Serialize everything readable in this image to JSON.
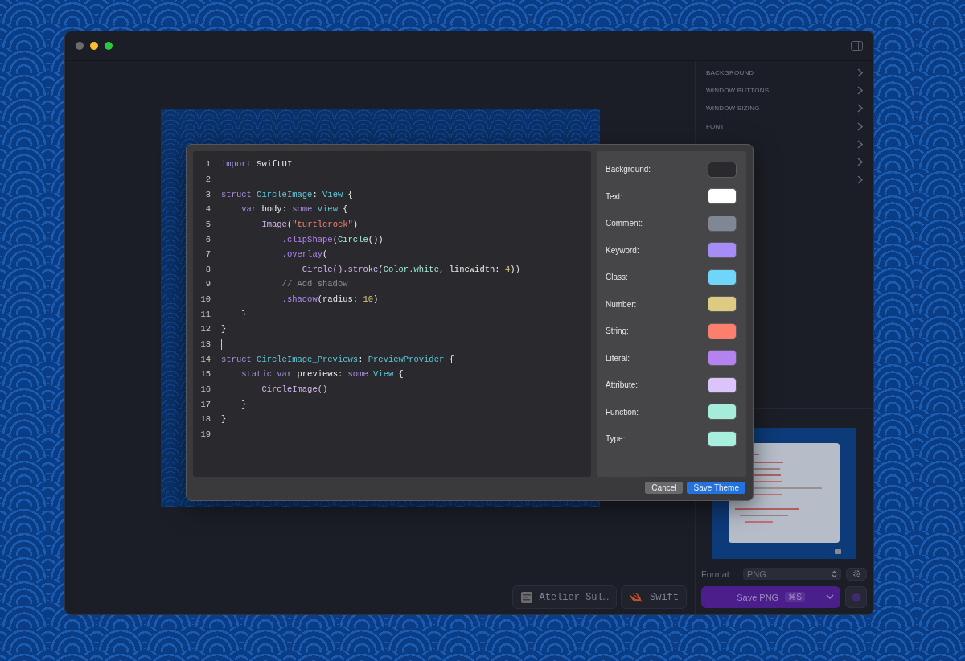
{
  "window": {
    "buttons": [
      {
        "color": "#6b6b70"
      },
      {
        "color": "#febc2e"
      },
      {
        "color": "#28c840"
      }
    ]
  },
  "sidebar": {
    "sections": [
      {
        "label": "BACKGROUND",
        "expandable": true
      },
      {
        "label": "WINDOW BUTTONS",
        "expandable": true
      },
      {
        "label": "WINDOW SIZING",
        "expandable": true
      },
      {
        "label": "FONT",
        "expandable": true
      },
      {
        "expandable": true
      },
      {
        "expandable": true
      },
      {
        "expandable": true
      }
    ],
    "format": {
      "label": "Format:",
      "value": "PNG"
    },
    "save": {
      "label": "Save PNG",
      "shortcut": "⌘S"
    }
  },
  "toolbar": {
    "theme_button": {
      "label": "Atelier Sul…"
    },
    "language_button": {
      "label": "Swift"
    }
  },
  "dialog": {
    "code": [
      {
        "n": "1",
        "tokens": [
          {
            "t": "import",
            "kind": "keyword"
          },
          {
            "t": " SwiftUI",
            "kind": "plain"
          }
        ]
      },
      {
        "n": "2"
      },
      {
        "n": "3",
        "tokens": [
          {
            "t": "struct ",
            "kind": "keyword"
          },
          {
            "t": "CircleImage",
            "kind": "class"
          },
          {
            "t": ": ",
            "kind": "plain"
          },
          {
            "t": "View",
            "kind": "class"
          },
          {
            "t": " {",
            "kind": "plain"
          }
        ]
      },
      {
        "n": "4",
        "tokens": [
          {
            "t": "    var",
            "kind": "keyword"
          },
          {
            "t": " body: ",
            "kind": "plain"
          },
          {
            "t": "some ",
            "kind": "keyword"
          },
          {
            "t": "View",
            "kind": "class"
          },
          {
            "t": " {",
            "kind": "plain"
          }
        ]
      },
      {
        "n": "5",
        "tokens": [
          {
            "t": "        Image",
            "kind": "attribute"
          },
          {
            "t": "(",
            "kind": "plain"
          },
          {
            "t": "\"turtlerock\"",
            "kind": "string"
          },
          {
            "t": ")",
            "kind": "plain"
          }
        ]
      },
      {
        "n": "6",
        "tokens": [
          {
            "t": "            .clipShape",
            "kind": "function"
          },
          {
            "t": "(",
            "kind": "plain"
          },
          {
            "t": "Circle",
            "kind": "type"
          },
          {
            "t": "())",
            "kind": "plain"
          }
        ]
      },
      {
        "n": "7",
        "tokens": [
          {
            "t": "            .overlay",
            "kind": "function"
          },
          {
            "t": "(",
            "kind": "plain"
          }
        ]
      },
      {
        "n": "8",
        "tokens": [
          {
            "t": "                Circle().stroke",
            "kind": "attribute"
          },
          {
            "t": "(",
            "kind": "plain"
          },
          {
            "t": "Color.white",
            "kind": "type"
          },
          {
            "t": ", lineWidth: ",
            "kind": "plain"
          },
          {
            "t": "4",
            "kind": "number"
          },
          {
            "t": "))",
            "kind": "plain"
          }
        ]
      },
      {
        "n": "9",
        "tokens": [
          {
            "t": "            // Add shadow",
            "kind": "comment"
          }
        ]
      },
      {
        "n": "10",
        "tokens": [
          {
            "t": "            .shadow",
            "kind": "function"
          },
          {
            "t": "(radius: ",
            "kind": "plain"
          },
          {
            "t": "10",
            "kind": "number"
          },
          {
            "t": ")",
            "kind": "plain"
          }
        ]
      },
      {
        "n": "11",
        "tokens": [
          {
            "t": "    }",
            "kind": "plain"
          }
        ]
      },
      {
        "n": "12",
        "tokens": [
          {
            "t": "}",
            "kind": "plain"
          }
        ]
      },
      {
        "n": "13",
        "cursor": true
      },
      {
        "n": "14",
        "tokens": [
          {
            "t": "struct ",
            "kind": "keyword"
          },
          {
            "t": "CircleImage_Previews",
            "kind": "class"
          },
          {
            "t": ": ",
            "kind": "plain"
          },
          {
            "t": "PreviewProvider",
            "kind": "class"
          },
          {
            "t": " {",
            "kind": "plain"
          }
        ]
      },
      {
        "n": "15",
        "tokens": [
          {
            "t": "    static var",
            "kind": "keyword"
          },
          {
            "t": " previews: ",
            "kind": "plain"
          },
          {
            "t": "some ",
            "kind": "keyword"
          },
          {
            "t": "View",
            "kind": "class"
          },
          {
            "t": " {",
            "kind": "plain"
          }
        ]
      },
      {
        "n": "16",
        "tokens": [
          {
            "t": "        CircleImage()",
            "kind": "attribute"
          }
        ]
      },
      {
        "n": "17",
        "tokens": [
          {
            "t": "    }",
            "kind": "plain"
          }
        ]
      },
      {
        "n": "18",
        "tokens": [
          {
            "t": "}",
            "kind": "plain"
          }
        ]
      },
      {
        "n": "19"
      }
    ],
    "theme": [
      {
        "label": "Background:",
        "color": "#2a2a2e"
      },
      {
        "label": "Text:",
        "color": "#ffffff"
      },
      {
        "label": "Comment:",
        "color": "#7f8794"
      },
      {
        "label": "Keyword:",
        "color": "#a58cf7"
      },
      {
        "label": "Class:",
        "color": "#6fd6fa"
      },
      {
        "label": "Number:",
        "color": "#dccb80"
      },
      {
        "label": "String:",
        "color": "#fc7f6d"
      },
      {
        "label": "Literal:",
        "color": "#b483f0"
      },
      {
        "label": "Attribute:",
        "color": "#dbc3fb"
      },
      {
        "label": "Function:",
        "color": "#a5ecdb"
      },
      {
        "label": "Type:",
        "color": "#a8efe0"
      }
    ],
    "buttons": [
      {
        "label": "Cancel",
        "kind": "secondary"
      },
      {
        "label": "Save Theme",
        "kind": "primary"
      }
    ]
  }
}
